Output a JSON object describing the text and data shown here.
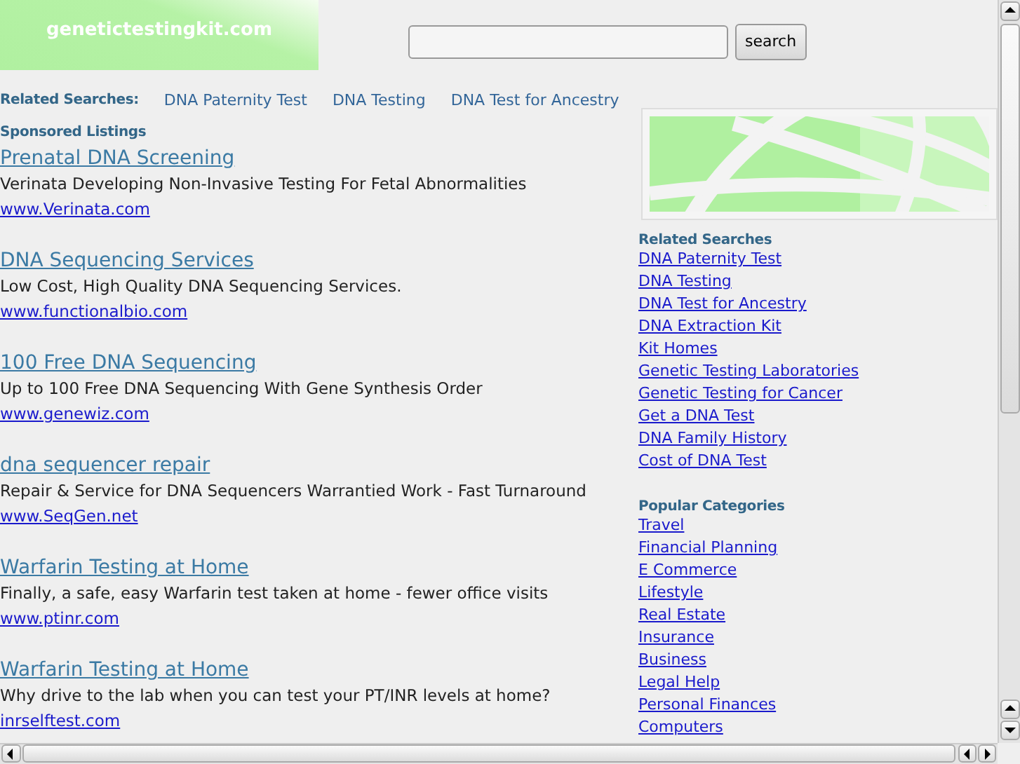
{
  "site_title": "genetictestingkit.com",
  "search": {
    "button": "search"
  },
  "related_bar": {
    "label": "Related Searches:",
    "links": [
      "DNA Paternity Test",
      "DNA Testing",
      "DNA Test for Ancestry"
    ]
  },
  "sponsored_heading": "Sponsored Listings",
  "listings": [
    {
      "title": "Prenatal DNA Screening",
      "description": "Verinata Developing Non-Invasive Testing For Fetal Abnormalities",
      "url": "www.Verinata.com"
    },
    {
      "title": "DNA Sequencing Services",
      "description": "Low Cost, High Quality DNA Sequencing Services.",
      "url": "www.functionalbio.com"
    },
    {
      "title": "100 Free DNA Sequencing",
      "description": "Up to 100 Free DNA Sequencing With Gene Synthesis Order",
      "url": "www.genewiz.com"
    },
    {
      "title": "dna sequencer repair",
      "description": "Repair & Service for DNA Sequencers Warrantied Work - Fast Turnaround",
      "url": "www.SeqGen.net"
    },
    {
      "title": "Warfarin Testing at Home",
      "description": "Finally, a safe, easy Warfarin test taken at home - fewer office visits",
      "url": "www.ptinr.com"
    },
    {
      "title": "Warfarin Testing at Home",
      "description": "Why drive to the lab when you can test your PT/INR levels at home?",
      "url": "inrselftest.com"
    }
  ],
  "sidebar": {
    "sections": [
      {
        "heading": "Related Searches",
        "links": [
          "DNA Paternity Test",
          "DNA Testing",
          "DNA Test for Ancestry",
          "DNA Extraction Kit",
          "Kit Homes",
          "Genetic Testing Laboratories",
          "Genetic Testing for Cancer",
          "Get a DNA Test",
          "DNA Family History",
          "Cost of DNA Test"
        ]
      },
      {
        "heading": "Popular Categories",
        "links": [
          "Travel",
          "Financial Planning",
          "E Commerce",
          "Lifestyle",
          "Real Estate",
          "Insurance",
          "Business",
          "Legal Help",
          "Personal Finances",
          "Computers"
        ]
      }
    ]
  }
}
